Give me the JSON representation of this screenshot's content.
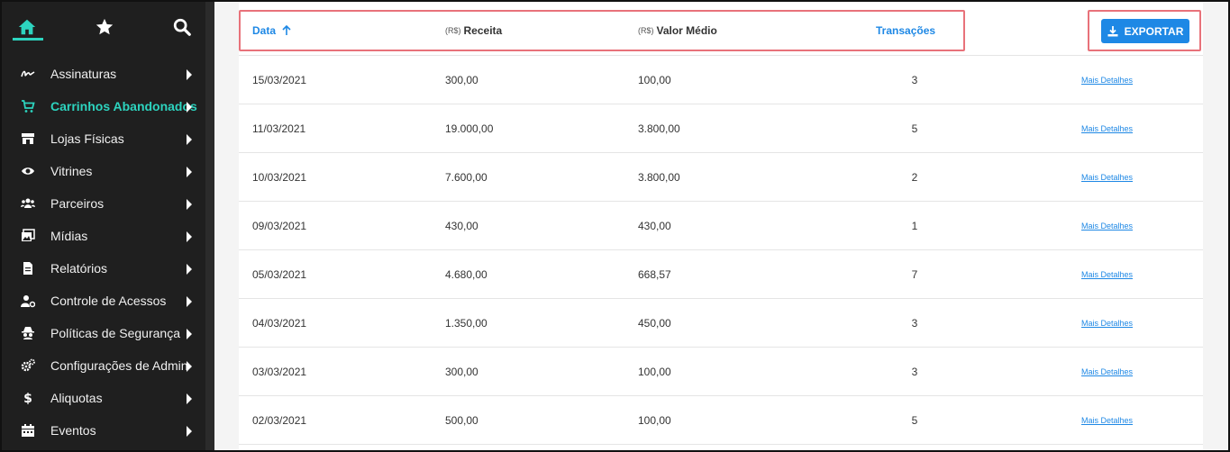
{
  "colors": {
    "accent": "#2dd4bf",
    "link": "#1e88e5",
    "highlight": "#e8727a",
    "sidebar_bg": "#1f1f1f"
  },
  "sidebar": {
    "top_icons": [
      "home-icon",
      "star-icon",
      "search-icon"
    ],
    "items": [
      {
        "label": "Assinaturas",
        "icon": "signature-icon"
      },
      {
        "label": "Carrinhos Abandonados",
        "icon": "cart-icon",
        "active": true
      },
      {
        "label": "Lojas Físicas",
        "icon": "store-icon"
      },
      {
        "label": "Vitrines",
        "icon": "eye-icon"
      },
      {
        "label": "Parceiros",
        "icon": "users-icon"
      },
      {
        "label": "Mídias",
        "icon": "media-icon"
      },
      {
        "label": "Relatórios",
        "icon": "file-icon"
      },
      {
        "label": "Controle de Acessos",
        "icon": "user-gear-icon"
      },
      {
        "label": "Políticas de Segurança",
        "icon": "spy-icon"
      },
      {
        "label": "Configurações de Admin",
        "icon": "cogs-icon"
      },
      {
        "label": "Aliquotas",
        "icon": "dollar-icon"
      },
      {
        "label": "Eventos",
        "icon": "calendar-icon"
      }
    ]
  },
  "table": {
    "columns": {
      "date": "Data",
      "revenue_unit": "(R$)",
      "revenue": "Receita",
      "avg_unit": "(R$)",
      "avg": "Valor Médio",
      "transactions": "Transações"
    },
    "export_label": "EXPORTAR",
    "details_label": "Mais Detalhes",
    "rows": [
      {
        "date": "15/03/2021",
        "revenue": "300,00",
        "avg": "100,00",
        "transactions": "3"
      },
      {
        "date": "11/03/2021",
        "revenue": "19.000,00",
        "avg": "3.800,00",
        "transactions": "5"
      },
      {
        "date": "10/03/2021",
        "revenue": "7.600,00",
        "avg": "3.800,00",
        "transactions": "2"
      },
      {
        "date": "09/03/2021",
        "revenue": "430,00",
        "avg": "430,00",
        "transactions": "1"
      },
      {
        "date": "05/03/2021",
        "revenue": "4.680,00",
        "avg": "668,57",
        "transactions": "7"
      },
      {
        "date": "04/03/2021",
        "revenue": "1.350,00",
        "avg": "450,00",
        "transactions": "3"
      },
      {
        "date": "03/03/2021",
        "revenue": "300,00",
        "avg": "100,00",
        "transactions": "3"
      },
      {
        "date": "02/03/2021",
        "revenue": "500,00",
        "avg": "100,00",
        "transactions": "5"
      }
    ]
  }
}
